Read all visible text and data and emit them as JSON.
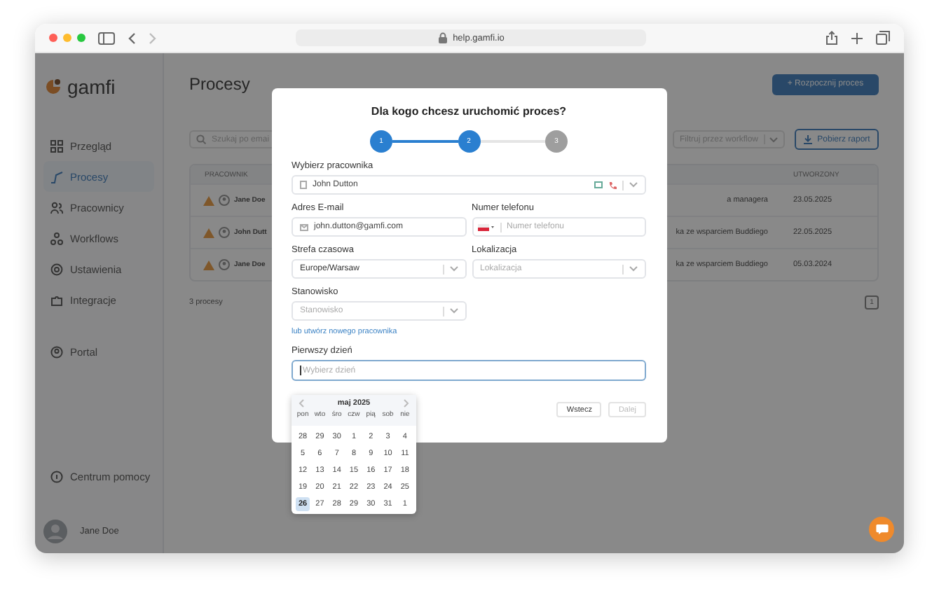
{
  "browser": {
    "url": "help.gamfi.io"
  },
  "sidebar": {
    "logo": "gamfi",
    "items": [
      {
        "label": "Przegląd",
        "selected": false
      },
      {
        "label": "Procesy",
        "selected": true
      },
      {
        "label": "Pracownicy",
        "selected": false
      },
      {
        "label": "Workflows",
        "selected": false
      },
      {
        "label": "Ustawienia",
        "selected": false
      },
      {
        "label": "Integracje",
        "selected": false
      }
    ],
    "portal": "Portal",
    "help": "Centrum pomocy",
    "user": "Jane Doe"
  },
  "page": {
    "title": "Procesy",
    "start_button": "+ Rozpocznij proces",
    "search_placeholder": "Szukaj po emai",
    "filter_placeholder": "Filtruj przez workflow",
    "report_button": "Pobierz raport",
    "table": {
      "columns": [
        "PRACOWNIK",
        "UTWORZONY"
      ],
      "rows": [
        {
          "warning": true,
          "employee": "Jane Doe",
          "workflow": "a managera",
          "created": "23.05.2025"
        },
        {
          "warning": true,
          "employee": "John Dutt",
          "workflow": "ka ze wsparciem Buddiego",
          "created": "22.05.2025"
        },
        {
          "warning": true,
          "employee": "Jane Doe",
          "workflow": "ka ze wsparciem Buddiego",
          "created": "05.03.2024"
        }
      ]
    },
    "count": "3 procesy",
    "pages": [
      {
        "label": "1",
        "selected": true
      }
    ]
  },
  "modal": {
    "title": "Dla kogo chcesz uruchomić proces?",
    "steps": [
      {
        "label": "1",
        "active": true
      },
      {
        "label": "2",
        "active": true
      },
      {
        "label": "3",
        "active": false
      }
    ],
    "employee": {
      "label": "Wybierz pracownika",
      "value": "John Dutton"
    },
    "email": {
      "label": "Adres E-mail",
      "value": "john.dutton@gamfi.com"
    },
    "phone": {
      "label": "Numer telefonu",
      "placeholder": "Numer telefonu"
    },
    "timezone": {
      "label": "Strefa czasowa",
      "value": "Europe/Warsaw"
    },
    "location": {
      "label": "Lokalizacja",
      "placeholder": "Lokalizacja"
    },
    "position": {
      "label": "Stanowisko",
      "placeholder": "Stanowisko"
    },
    "create_link": "lub utwórz nowego pracownika",
    "first_day": {
      "label": "Pierwszy dzień",
      "placeholder": "Wybierz dzień",
      "focused": true
    },
    "calendar": {
      "month": "maj 2025",
      "weekdays": [
        "pon",
        "wto",
        "śro",
        "czw",
        "pią",
        "sob",
        "nie"
      ],
      "weeks": [
        [
          {
            "day": "28",
            "selected": false
          },
          {
            "day": "29",
            "selected": false
          },
          {
            "day": "30",
            "selected": false
          },
          {
            "day": "1",
            "selected": false
          },
          {
            "day": "2",
            "selected": false
          },
          {
            "day": "3",
            "selected": false
          },
          {
            "day": "4",
            "selected": false
          }
        ],
        [
          {
            "day": "5",
            "selected": false
          },
          {
            "day": "6",
            "selected": false
          },
          {
            "day": "7",
            "selected": false
          },
          {
            "day": "8",
            "selected": false
          },
          {
            "day": "9",
            "selected": false
          },
          {
            "day": "10",
            "selected": false
          },
          {
            "day": "11",
            "selected": false
          }
        ],
        [
          {
            "day": "12",
            "selected": false
          },
          {
            "day": "13",
            "selected": false
          },
          {
            "day": "14",
            "selected": false
          },
          {
            "day": "15",
            "selected": false
          },
          {
            "day": "16",
            "selected": false
          },
          {
            "day": "17",
            "selected": false
          },
          {
            "day": "18",
            "selected": false
          }
        ],
        [
          {
            "day": "19",
            "selected": false
          },
          {
            "day": "20",
            "selected": false
          },
          {
            "day": "21",
            "selected": false
          },
          {
            "day": "22",
            "selected": false
          },
          {
            "day": "23",
            "selected": false
          },
          {
            "day": "24",
            "selected": false
          },
          {
            "day": "25",
            "selected": false
          }
        ],
        [
          {
            "day": "26",
            "selected": true
          },
          {
            "day": "27",
            "selected": false
          },
          {
            "day": "28",
            "selected": false
          },
          {
            "day": "29",
            "selected": false
          },
          {
            "day": "30",
            "selected": false
          },
          {
            "day": "31",
            "selected": false
          },
          {
            "day": "1",
            "selected": false
          }
        ]
      ]
    },
    "back_button": "Wstecz",
    "next_button": {
      "label": "Dalej",
      "disabled": true
    }
  }
}
